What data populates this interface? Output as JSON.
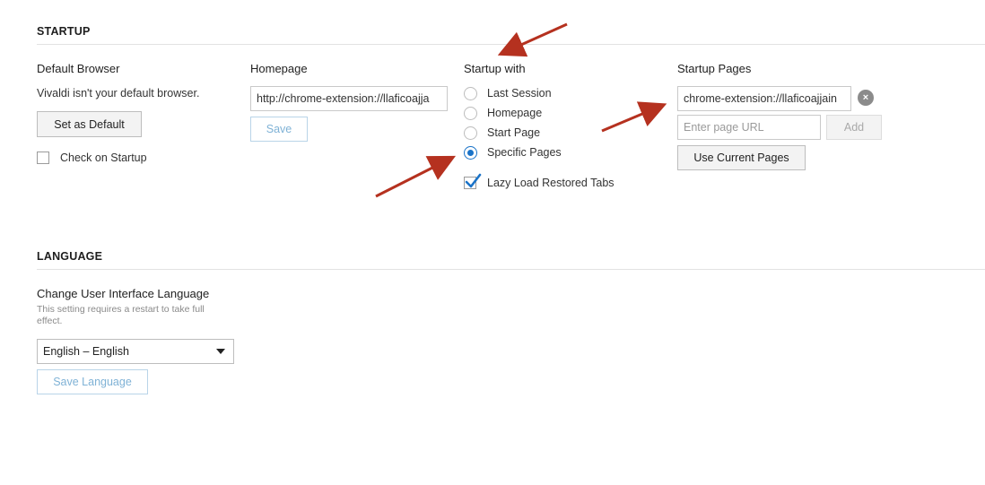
{
  "startup": {
    "section_title": "STARTUP",
    "default_browser": {
      "title": "Default Browser",
      "status_text": "Vivaldi isn't your default browser.",
      "set_default_label": "Set as Default",
      "check_on_startup_label": "Check on Startup",
      "check_on_startup_checked": false
    },
    "homepage": {
      "title": "Homepage",
      "url_value": "http://chrome-extension://llaficoajja",
      "save_label": "Save"
    },
    "startup_with": {
      "title": "Startup with",
      "options": [
        {
          "label": "Last Session",
          "selected": false
        },
        {
          "label": "Homepage",
          "selected": false
        },
        {
          "label": "Start Page",
          "selected": false
        },
        {
          "label": "Specific Pages",
          "selected": true
        }
      ],
      "lazy_load_label": "Lazy Load Restored Tabs",
      "lazy_load_checked": true
    },
    "startup_pages": {
      "title": "Startup Pages",
      "page_value": "chrome-extension://llaficoajjain",
      "clear_glyph": "×",
      "new_page_placeholder": "Enter page URL",
      "add_label": "Add",
      "use_current_label": "Use Current Pages"
    }
  },
  "language": {
    "section_title": "LANGUAGE",
    "title": "Change User Interface Language",
    "note": "This setting requires a restart to take full effect.",
    "selected_language": "English – English",
    "save_label": "Save Language"
  },
  "colors": {
    "accent": "#1a73c8",
    "annotation_arrow": "#b5311f"
  },
  "icons": {
    "clear": "clear-icon",
    "checkmark": "checkmark-icon",
    "dropdown": "chevron-down-icon",
    "annotation": "annotation-arrow"
  }
}
